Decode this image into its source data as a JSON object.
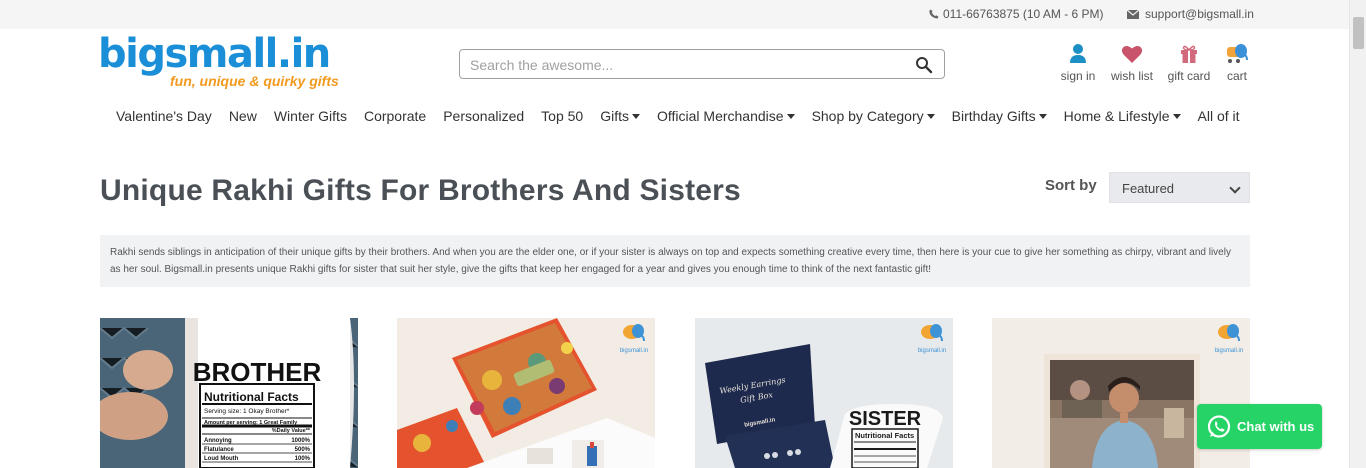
{
  "topbar": {
    "phone": "011-66763875 (10 AM - 6 PM)",
    "email": "support@bigsmall.in"
  },
  "logo": {
    "name": "bigsmall.in",
    "tagline": "fun, unique & quirky gifts"
  },
  "search": {
    "placeholder": "Search the awesome..."
  },
  "user_links": [
    {
      "label": "sign in",
      "icon": "user-icon"
    },
    {
      "label": "wish list",
      "icon": "heart-icon"
    },
    {
      "label": "gift card",
      "icon": "gift-icon"
    },
    {
      "label": "cart",
      "icon": "cart-icon"
    }
  ],
  "nav": [
    {
      "label": "Valentine's Day"
    },
    {
      "label": "New"
    },
    {
      "label": "Winter Gifts"
    },
    {
      "label": "Corporate"
    },
    {
      "label": "Personalized"
    },
    {
      "label": "Top 50"
    },
    {
      "label": "Gifts",
      "dropdown": true
    },
    {
      "label": "Official Merchandise",
      "dropdown": true
    },
    {
      "label": "Shop by Category",
      "dropdown": true
    },
    {
      "label": "Birthday Gifts",
      "dropdown": true
    },
    {
      "label": "Home & Lifestyle",
      "dropdown": true
    },
    {
      "label": "All of it"
    }
  ],
  "page": {
    "title": "Unique Rakhi Gifts For Brothers And Sisters",
    "sort_label": "Sort by",
    "sort_value": "Featured",
    "description": "Rakhi sends siblings in anticipation of their unique gifts by their brothers. And when you are the elder one, or if your sister is always on top and expects something creative every time, then here is your cue to give her something as chirpy, vibrant and lively as her soul. Bigsmall.in presents unique Rakhi gifts for sister that suit her style, give the gifts that keep her engaged for a year and gives you enough time to think of the next fantastic gift!"
  },
  "products": [
    {
      "mug_title": "BROTHER",
      "facts_title": "Nutritional Facts",
      "serving": "Serving size: 1 Okay Brother*",
      "amount": "Amount per serving: 1 Great Family",
      "dv": "%Daily Value**",
      "rows": [
        {
          "k": "Annoying",
          "v": "1000%"
        },
        {
          "k": "Flatulance",
          "v": "500%"
        },
        {
          "k": "Loud Mouth",
          "v": "100%"
        }
      ]
    },
    {
      "watermark": "bigsmall.in"
    },
    {
      "watermark": "bigsmall.in",
      "box_line1": "Weekly Earrings",
      "box_line2": "Gift Box",
      "brand": "bigsmall.in",
      "mug_title": "SISTER",
      "facts_title": "Nutritional Facts"
    },
    {
      "watermark": "bigsmall.in"
    }
  ],
  "chat": {
    "label": "Chat with us"
  },
  "colors": {
    "brand_blue": "#1a8fd8",
    "brand_orange": "#f29a1f",
    "whatsapp_green": "#25d366",
    "title_gray": "#4a5056"
  }
}
